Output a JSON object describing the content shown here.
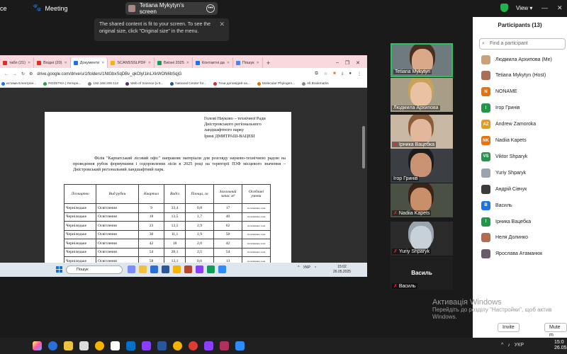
{
  "topbar": {
    "app_title": "ce",
    "meeting_label": "Meeting",
    "share_label": "Tetiana Mykytyn's screen",
    "view_label": "View",
    "minimize": "—",
    "close": "✕"
  },
  "tooltip": {
    "text": "The shared content is fit to your screen. To see the original size, click \"Original size\" in the menu."
  },
  "browser": {
    "tabs": [
      {
        "label": "табл (21)",
        "color": "#d93025"
      },
      {
        "label": "Вхідні (20)",
        "color": "#d93025"
      },
      {
        "label": "Документи",
        "color": "#1a73e8",
        "active": true
      },
      {
        "label": "SCANSSSLPDF",
        "color": "#f4b400"
      },
      {
        "label": "Виїзні 2025",
        "color": "#0f9d58"
      },
      {
        "label": "Контактні да",
        "color": "#1a73e8"
      },
      {
        "label": "Пошук",
        "color": "#4285f4"
      }
    ],
    "url": "drive.google.com/drive/u/1/folders/1NtGbxSqDBv_qkOlyI1inLXkWON6bSqjG",
    "bookmarks": [
      {
        "label": "истема Електрон...",
        "color": "#1a73e8"
      },
      {
        "label": "ROZETKA | Лнтерн...",
        "color": "#22a04b"
      },
      {
        "label": "192.168.200.112",
        "color": "#888"
      },
      {
        "label": "Web of Science [v.5...",
        "color": "#5a2d82"
      },
      {
        "label": "National Center for...",
        "color": "#205493"
      },
      {
        "label": "Тези доповідей на...",
        "color": "#d93025"
      },
      {
        "label": "Molecular Phylogen...",
        "color": "#e37400"
      },
      {
        "label": "All Bookmarks",
        "color": "#888"
      }
    ]
  },
  "document": {
    "header_lines": [
      "Голові Науково – технічної Ради",
      "Дністровського регіонального",
      "ландшафтного парку",
      "Ірині ДМИТРАШ-ВАЦЕБІ"
    ],
    "body": "Філія \"Карпатський лісовий офіс\" направляє матеріали для розгляду науково-технічною радою на проведення рубок формування і оздоровлення лісів в 2025 році на території ПЗФ місцевого значення – Дністровський регіональний ландшафтний парк.",
    "columns": [
      "Лісництво",
      "Вид рубки",
      "Квартал",
      "Виділ",
      "Площа, га",
      "Загальний запас м³",
      "Особливі умови"
    ],
    "rows": [
      [
        "Черніледьке",
        "Освітлення",
        "9",
        "33,4",
        "0,8",
        "17",
        "посилювана зона"
      ],
      [
        "Черніледьке",
        "Освітлення",
        "18",
        "13,5",
        "1,7",
        "40",
        "посилювана зона"
      ],
      [
        "Черніледьке",
        "Освітлення",
        "23",
        "13,5",
        "2,9",
        "62",
        "посилювана зона"
      ],
      [
        "Черніледьке",
        "Освітлення",
        "30",
        "11,1",
        "1,9",
        "50",
        "посилювана зона"
      ],
      [
        "Черніледьке",
        "Освітлення",
        "42",
        "18",
        "2,0",
        "42",
        "посилювана зона"
      ],
      [
        "Черніледьке",
        "Освітлення",
        "54",
        "28,1",
        "2,5",
        "54",
        "посилювана зона"
      ],
      [
        "Черніледьке",
        "Освітлення",
        "58",
        "13,1",
        "0,6",
        "13",
        "посилювана зона"
      ]
    ]
  },
  "inner_taskbar": {
    "search": "Пошук",
    "lang": "УКР",
    "time": "15:02",
    "date": "26.05.2025"
  },
  "videos": [
    {
      "name": "Tetiana Mykytyn",
      "muted": false,
      "active": true,
      "skin": "#d9a98a",
      "hair": "#4a2e1f",
      "bg": "#6f7a7f"
    },
    {
      "name": "Людмила Архипова",
      "muted": false,
      "skin": "#e9c2a4",
      "hair": "#c9a25a",
      "bg": "#a89e88"
    },
    {
      "name": "Ірника Вацебка",
      "muted": true,
      "skin": "#e2b79c",
      "hair": "#8a5d3a",
      "bg": "#c8b7a2"
    },
    {
      "name": "Ігор Гринів",
      "muted": false,
      "skin": "#c99273",
      "hair": "#1c1c1c",
      "bg": "#3b3e43"
    },
    {
      "name": "Nadiia Kapets",
      "muted": true,
      "skin": "#c98e6a",
      "hair": "#3a2416",
      "bg": "#4a5043"
    },
    {
      "name": "Yuriy Shparyk",
      "muted": true,
      "skin": "#c8d0d8",
      "hair": "#9aa4ad",
      "bg": "#2a2a2a"
    },
    {
      "name": "Василь",
      "muted": true,
      "big_name": "Василь"
    }
  ],
  "participants": {
    "title": "Participants (13)",
    "search_placeholder": "Find a participant",
    "list": [
      {
        "name": "Людмила Архипова (Me)",
        "initials": "",
        "color": "#c9a27b"
      },
      {
        "name": "Tetiana Mykytyn (Host)",
        "initials": "",
        "color": "#a96d58"
      },
      {
        "name": "NONAME",
        "initials": "N",
        "color": "#e8730c"
      },
      {
        "name": "Ігор Гринів",
        "initials": "І",
        "color": "#23964a"
      },
      {
        "name": "Andrew Zamoroka",
        "initials": "AZ",
        "color": "#e89a17"
      },
      {
        "name": "Nadiia Kapets",
        "initials": "NK",
        "color": "#e8730c"
      },
      {
        "name": "Viktor Shparyk",
        "initials": "VS",
        "color": "#23964a"
      },
      {
        "name": "Yuriy Shparyk",
        "initials": "",
        "color": "#9aa4ad"
      },
      {
        "name": "Андрій Сівчук",
        "initials": "",
        "color": "#3b3b3b"
      },
      {
        "name": "Василь",
        "initials": "В",
        "color": "#1a73e8"
      },
      {
        "name": "Ірника Вацебка",
        "initials": "І",
        "color": "#23964a"
      },
      {
        "name": "Неля Долинко",
        "initials": "",
        "color": "#b36a4f"
      },
      {
        "name": "Ярослава Атаманюк",
        "initials": "",
        "color": "#6a5a6e"
      }
    ],
    "invite_label": "Invite",
    "mute_label": "Mute m"
  },
  "activation": {
    "title": "Активація Windows",
    "line1": "Перейдіть до розділу \"Настройки\", щоб актив",
    "line2": "Windows."
  },
  "taskbar": {
    "lang": "УКР",
    "time": "15:0",
    "date": "26.05."
  }
}
